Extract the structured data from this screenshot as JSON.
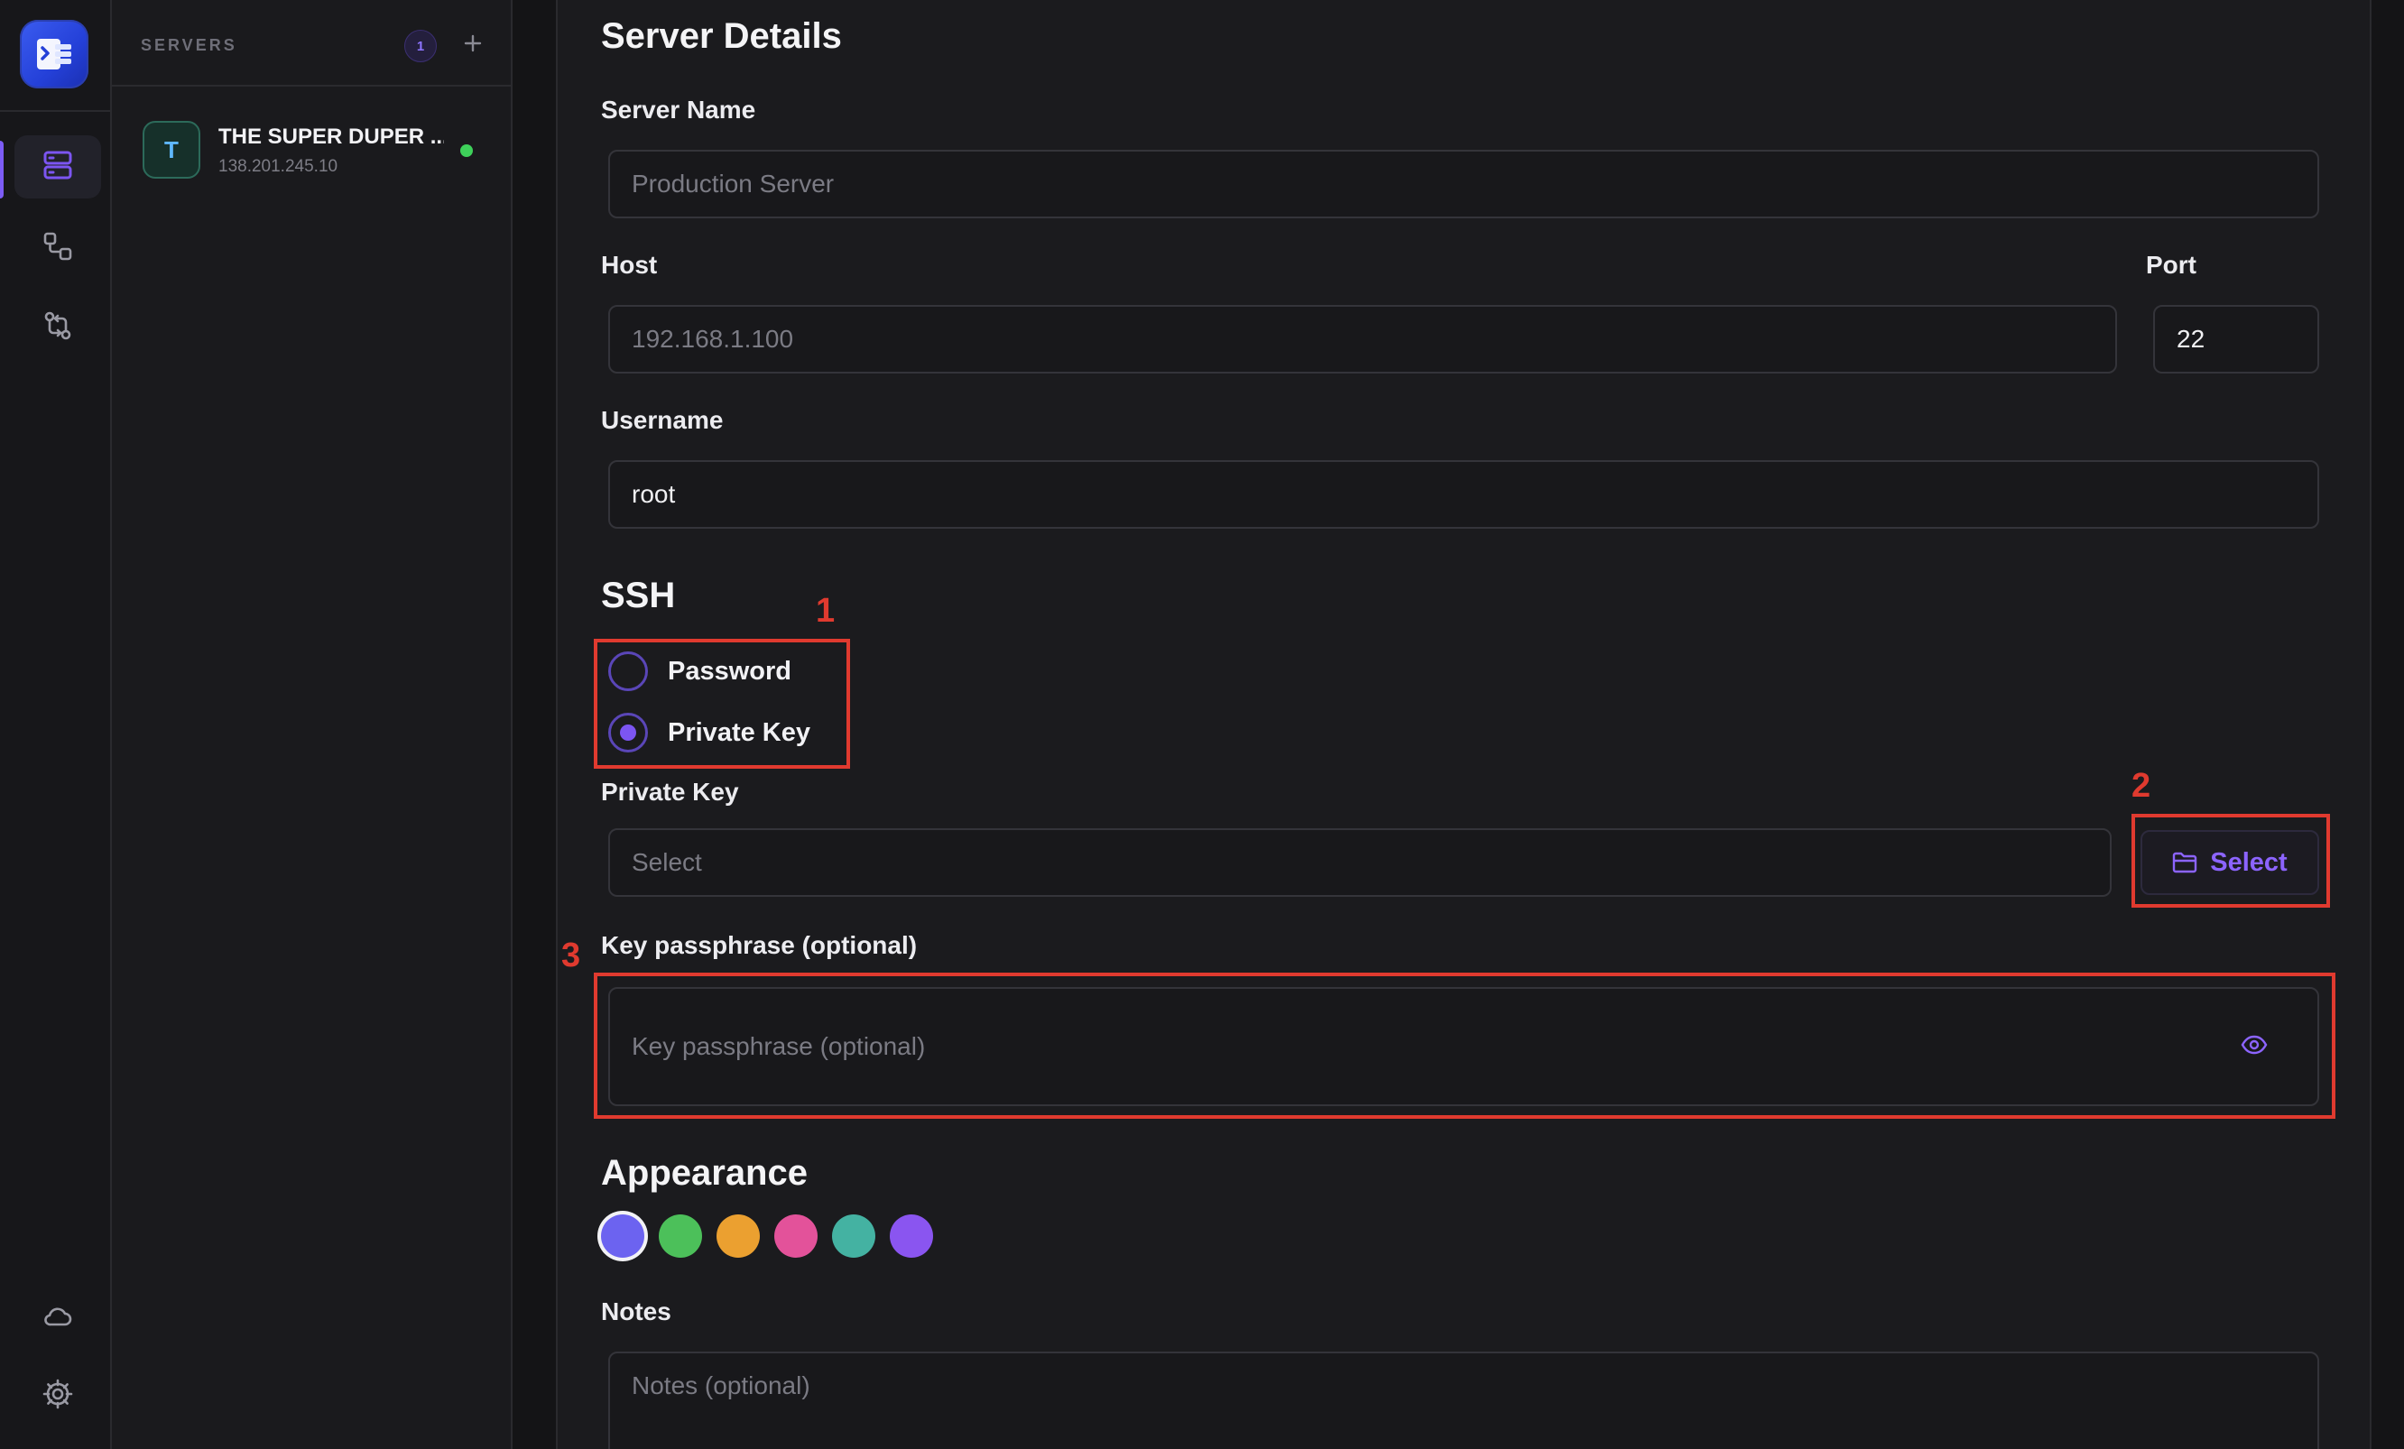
{
  "rail": {
    "icons": [
      "logo-icon",
      "servers-icon",
      "connections-icon",
      "sync-icon",
      "cloud-icon",
      "settings-icon"
    ]
  },
  "sidebar": {
    "title": "SERVERS",
    "count": "1",
    "add_label": "+",
    "servers": [
      {
        "avatar": "T",
        "name": "THE SUPER DUPER ...",
        "ip": "138.201.245.10",
        "status": "online"
      }
    ]
  },
  "form": {
    "section_title": "Server Details",
    "server_name": {
      "label": "Server Name",
      "placeholder": "Production Server",
      "value": ""
    },
    "host": {
      "label": "Host",
      "placeholder": "192.168.1.100",
      "value": ""
    },
    "port": {
      "label": "Port",
      "value": "22"
    },
    "username": {
      "label": "Username",
      "value": "root"
    },
    "ssh": {
      "title": "SSH",
      "options": [
        "Password",
        "Private Key"
      ],
      "selected": "Private Key"
    },
    "private_key": {
      "label": "Private Key",
      "placeholder": "Select",
      "button": "Select"
    },
    "passphrase": {
      "label": "Key passphrase (optional)",
      "placeholder": "Key passphrase (optional)"
    },
    "appearance": {
      "title": "Appearance",
      "colors": [
        "#6c63f0",
        "#4cc05a",
        "#eba030",
        "#e3529a",
        "#44b2a2",
        "#8a55f0"
      ],
      "selected_index": 0
    },
    "notes": {
      "label": "Notes",
      "placeholder": "Notes (optional)"
    }
  },
  "annotations": [
    "1",
    "2",
    "3"
  ],
  "theme": {
    "accent": "#7c55f2",
    "annotation": "#e03a2f",
    "online": "#3ed15a"
  }
}
